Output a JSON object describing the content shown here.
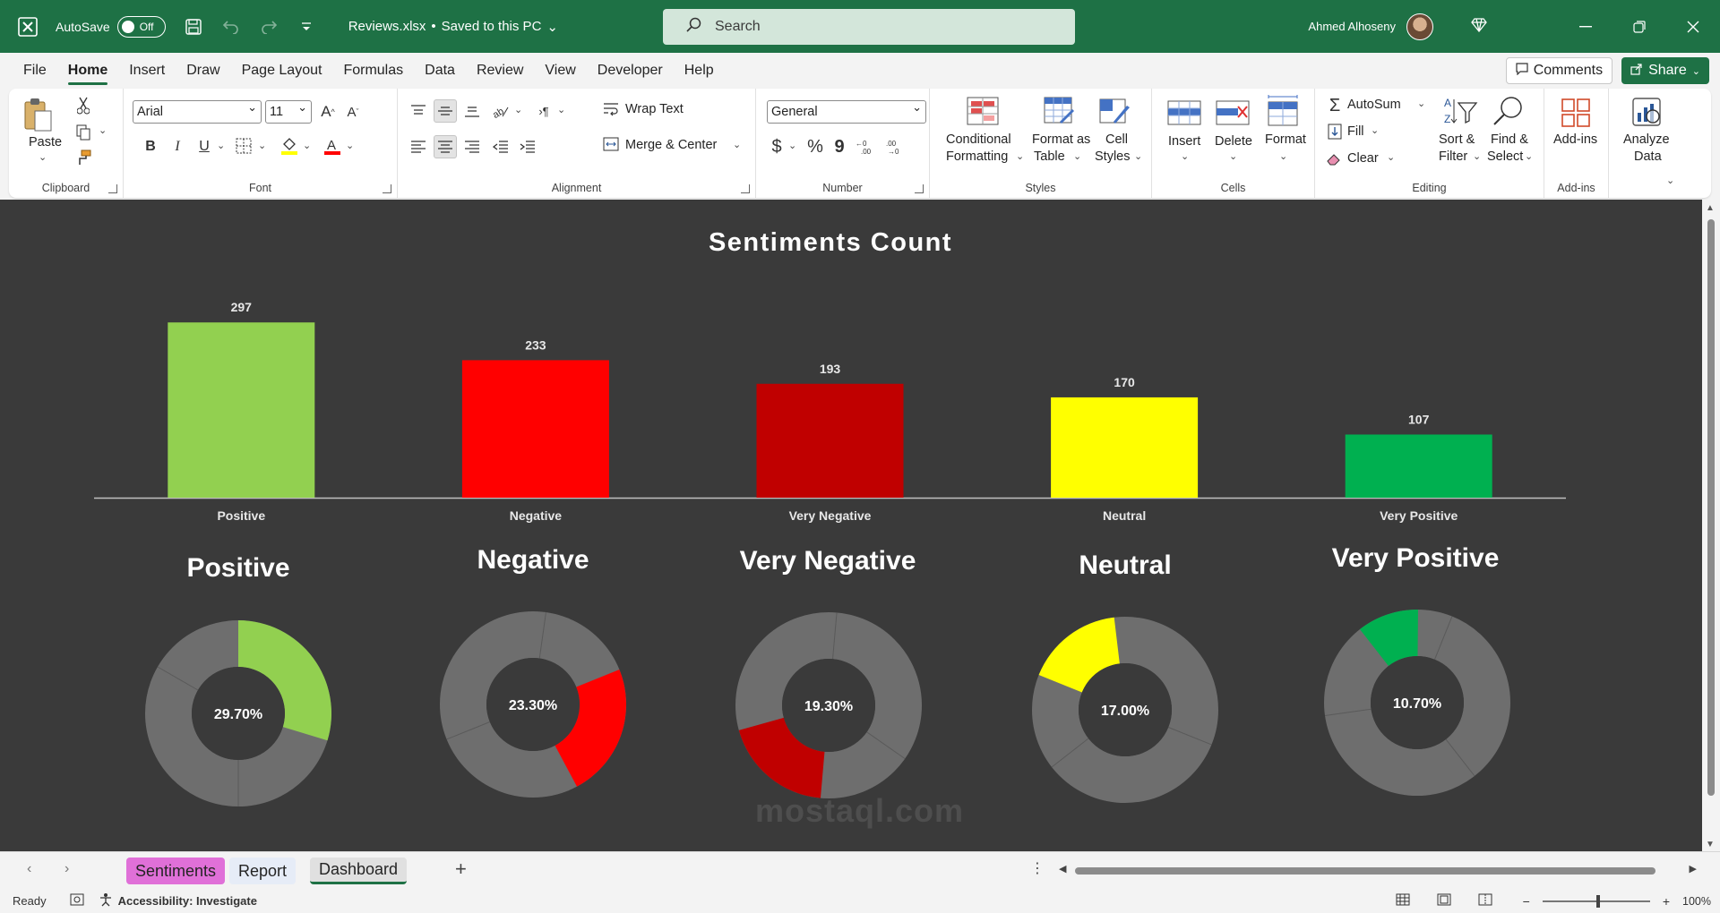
{
  "titlebar": {
    "autosave_label": "AutoSave",
    "autosave_state": "Off",
    "filename": "Reviews.xlsx",
    "save_status": "Saved to this PC",
    "search_placeholder": "Search",
    "user_name": "Ahmed Alhoseny"
  },
  "menu": {
    "tabs": [
      "File",
      "Home",
      "Insert",
      "Draw",
      "Page Layout",
      "Formulas",
      "Data",
      "Review",
      "View",
      "Developer",
      "Help"
    ],
    "active": "Home",
    "comments_label": "Comments",
    "share_label": "Share"
  },
  "ribbon": {
    "clipboard": {
      "label": "Clipboard",
      "paste": "Paste"
    },
    "font": {
      "label": "Font",
      "font_name": "Arial",
      "font_size": "11",
      "bold": "B",
      "italic": "I",
      "underline": "U"
    },
    "alignment": {
      "label": "Alignment",
      "wrap_text": "Wrap Text",
      "merge_center": "Merge & Center"
    },
    "number": {
      "label": "Number",
      "format": "General",
      "currency": "$",
      "percent": "%",
      "comma": "9"
    },
    "styles": {
      "label": "Styles",
      "conditional_1": "Conditional",
      "conditional_2": "Formatting",
      "format_table_1": "Format as",
      "format_table_2": "Table",
      "cell_styles_1": "Cell",
      "cell_styles_2": "Styles"
    },
    "cells": {
      "label": "Cells",
      "insert": "Insert",
      "delete": "Delete",
      "format": "Format"
    },
    "editing": {
      "label": "Editing",
      "autosum": "AutoSum",
      "fill": "Fill",
      "clear": "Clear",
      "sort_1": "Sort &",
      "sort_2": "Filter",
      "find_1": "Find &",
      "find_2": "Select"
    },
    "addins": {
      "label": "Add-ins",
      "addins": "Add-ins"
    },
    "analyze": {
      "analyze_1": "Analyze",
      "analyze_2": "Data"
    }
  },
  "chart_data": [
    {
      "type": "bar",
      "title": "Sentiments Count",
      "categories": [
        "Positive",
        "Negative",
        "Very Negative",
        "Neutral",
        "Very Positive"
      ],
      "values": [
        297,
        233,
        193,
        170,
        107
      ],
      "colors": [
        "#92d050",
        "#ff0000",
        "#c00000",
        "#ffff00",
        "#00b050"
      ],
      "ylim": [
        0,
        320
      ],
      "grid": false
    },
    {
      "type": "pie",
      "variant": "donut",
      "title": "Positive",
      "center_label": "29.70%",
      "value": 29.7,
      "color": "#92d050"
    },
    {
      "type": "pie",
      "variant": "donut",
      "title": "Negative",
      "center_label": "23.30%",
      "value": 23.3,
      "color": "#ff0000"
    },
    {
      "type": "pie",
      "variant": "donut",
      "title": "Very Negative",
      "center_label": "19.30%",
      "value": 19.3,
      "color": "#c00000"
    },
    {
      "type": "pie",
      "variant": "donut",
      "title": "Neutral",
      "center_label": "17.00%",
      "value": 17.0,
      "color": "#ffff00"
    },
    {
      "type": "pie",
      "variant": "donut",
      "title": "Very Positive",
      "center_label": "10.70%",
      "value": 10.7,
      "color": "#00b050"
    }
  ],
  "sheets": {
    "tabs": [
      "Sentiments",
      "Report",
      "Dashboard"
    ],
    "active": "Dashboard"
  },
  "status": {
    "ready": "Ready",
    "accessibility": "Accessibility: Investigate",
    "zoom": "100%"
  },
  "watermark": "mostaql.com",
  "colors": {
    "brand": "#1e7145",
    "sheet_bg": "#3a3a3a",
    "donut_track": "#6e6e6e"
  }
}
